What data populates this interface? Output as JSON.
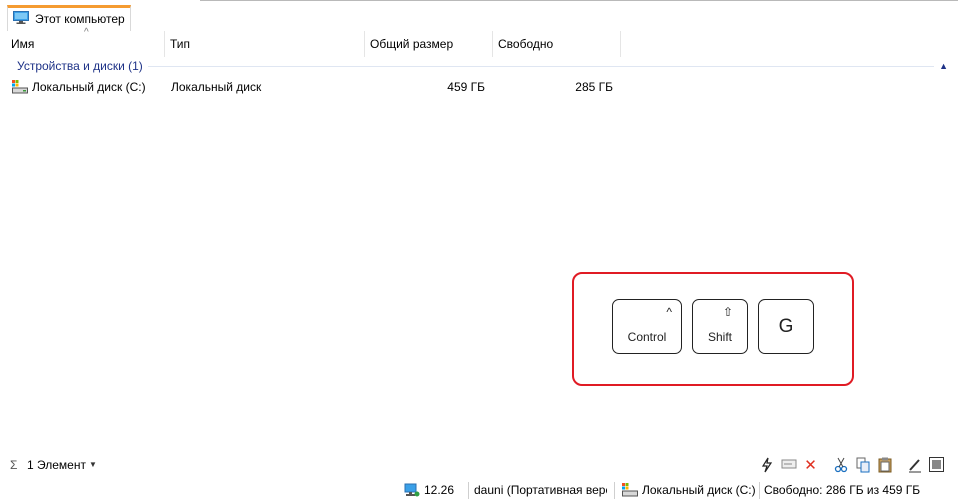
{
  "tab": {
    "label": "Этот компьютер"
  },
  "columns": [
    {
      "label": "Имя"
    },
    {
      "label": "Тип"
    },
    {
      "label": "Общий размер"
    },
    {
      "label": "Свободно"
    }
  ],
  "group": {
    "label": "Устройства и диски (1)"
  },
  "rows": [
    {
      "name": "Локальный диск (C:)",
      "type": "Локальный диск",
      "total": "459 ГБ",
      "free": "285 ГБ"
    }
  ],
  "shortcut": {
    "keys": [
      {
        "symbol": "^",
        "label": "Control"
      },
      {
        "symbol": "⇧",
        "label": "Shift"
      },
      {
        "label": "G"
      }
    ],
    "border_color": "#e01b24"
  },
  "status": {
    "sigma": "Σ",
    "count": "1 Элемент",
    "segments": {
      "version": "12.26",
      "user": "dauni (Портативная версия)",
      "drive": "Локальный диск (C:)",
      "free": "Свободно: 286 ГБ из 459 ГБ"
    }
  },
  "colors": {
    "accent_tab": "#f59b31",
    "group_text": "#1e3287"
  }
}
